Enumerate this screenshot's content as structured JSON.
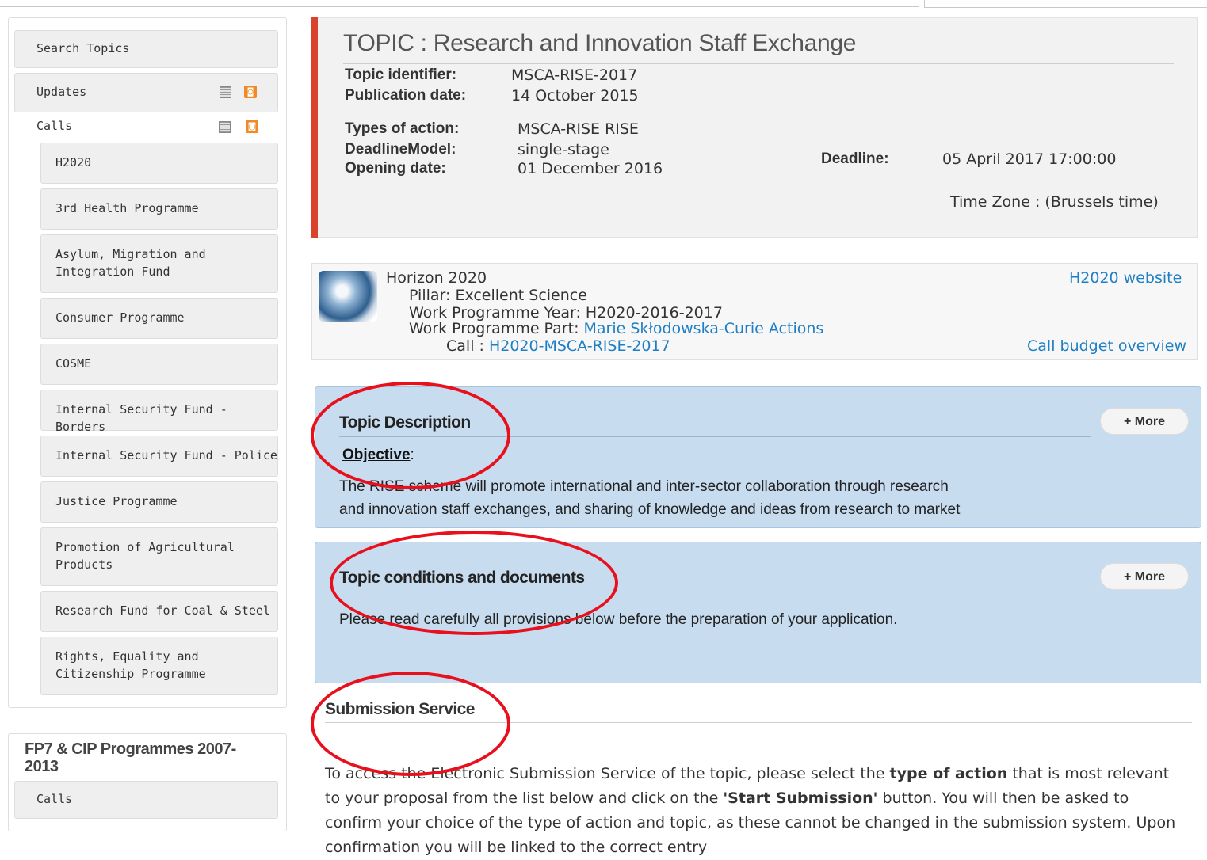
{
  "sidebar": {
    "search_topics": "Search Topics",
    "updates": "Updates",
    "calls": "Calls",
    "programmes": [
      "H2020",
      "3rd Health Programme",
      "Asylum, Migration and Integration Fund",
      "Consumer Programme",
      "COSME",
      "Internal Security Fund - Borders",
      "Internal Security Fund - Police",
      "Justice Programme",
      "Promotion of Agricultural Products",
      "Research Fund for Coal & Steel",
      "Rights, Equality and Citizenship Programme"
    ],
    "fp7_title": "FP7 & CIP Programmes 2007-2013",
    "fp7_calls": "Calls"
  },
  "topic": {
    "title": "TOPIC : Research and Innovation Staff Exchange",
    "labels": {
      "identifier": "Topic identifier:",
      "publication": "Publication date:",
      "types": "Types of action:",
      "deadline_model": "DeadlineModel:",
      "opening": "Opening date:",
      "deadline": "Deadline:"
    },
    "identifier": "MSCA-RISE-2017",
    "publication_date": "14 October 2015",
    "types_of_action": "MSCA-RISE RISE",
    "deadline_model": "single-stage",
    "opening_date": "01 December 2016",
    "deadline": "05 April 2017 17:00:00",
    "time_zone": "Time Zone : (Brussels time)"
  },
  "programme": {
    "name": "Horizon 2020",
    "pillar": "Pillar: Excellent Science",
    "wp_year": "Work Programme Year: H2020-2016-2017",
    "wp_part_label": "Work Programme Part: ",
    "wp_part_link": "Marie Skłodowska-Curie Actions",
    "call_label": "Call : ",
    "call_link": "H2020-MSCA-RISE-2017",
    "website_link": "H2020 website",
    "budget_link": "Call budget overview"
  },
  "description": {
    "title": "Topic Description",
    "more": "+ More",
    "objective": "Objective",
    "objective_colon": ":",
    "line1": "The RISE scheme will promote international and inter-sector collaboration through research",
    "line2": "and innovation staff exchanges, and sharing of knowledge and ideas from research to market"
  },
  "conditions": {
    "title": "Topic conditions and documents",
    "more": "+ More",
    "text": "Please read carefully all provisions below before the preparation of your application."
  },
  "submission": {
    "title": "Submission Service",
    "p1": "To access the Electronic Submission Service of the topic, please select the ",
    "p1_bold": "type of action",
    "p2": " that is most relevant to your proposal from the list below and click on the ",
    "p2_bold": "'Start Submission'",
    "p3": " button. You will then be asked to confirm your choice of the type of action and topic, as these cannot be changed in the submission system. Upon confirmation you will be linked to the correct entry"
  },
  "colors": {
    "accent_red": "#d9432b",
    "annotation_red": "#e8101c",
    "link_blue": "#1f7fc4",
    "section_blue": "#c8dcf0"
  }
}
